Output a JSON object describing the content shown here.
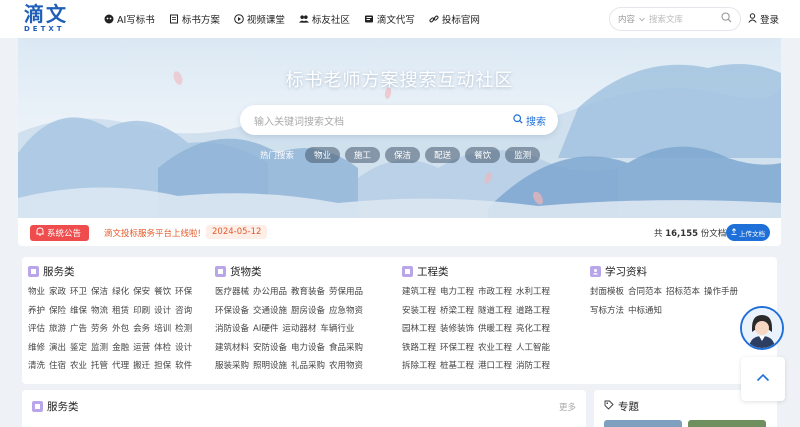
{
  "header": {
    "logo": {
      "main": "滴文",
      "sub": "DETXT"
    },
    "nav": [
      {
        "label": "AI写标书",
        "icon": "robot-icon"
      },
      {
        "label": "标书方案",
        "icon": "document-icon"
      },
      {
        "label": "视频课堂",
        "icon": "play-icon"
      },
      {
        "label": "标友社区",
        "icon": "users-icon"
      },
      {
        "label": "滴文代写",
        "icon": "edit-icon"
      },
      {
        "label": "投标官网",
        "icon": "link-icon"
      }
    ],
    "search": {
      "select": "内容",
      "placeholder": "搜索文库"
    },
    "login": "登录"
  },
  "banner": {
    "title": "标书老师方案搜索互动社区",
    "search_placeholder": "输入关键词搜索文档",
    "search_button": "搜索",
    "hot_label": "热门搜索",
    "hot_tags": [
      "物业",
      "施工",
      "保洁",
      "配送",
      "餐饮",
      "监测"
    ]
  },
  "notice": {
    "badge": "系统公告",
    "text": "滴文投标服务平台上线啦!",
    "date": "2024-05-12",
    "count_prefix": "共",
    "count": "16,155",
    "count_suffix": "份文档",
    "upload": "上传文档"
  },
  "categories": [
    {
      "title": "服务类",
      "rows": [
        [
          "物业",
          "家政",
          "环卫",
          "保洁",
          "绿化",
          "保安",
          "餐饮",
          "环保"
        ],
        [
          "养护",
          "保险",
          "维保",
          "物流",
          "租赁",
          "印刷",
          "设计",
          "咨询"
        ],
        [
          "评估",
          "旅游",
          "广告",
          "劳务",
          "外包",
          "会务",
          "培训",
          "检测"
        ],
        [
          "维修",
          "演出",
          "鉴定",
          "监测",
          "金融",
          "运营",
          "体检",
          "设计"
        ],
        [
          "清洗",
          "住宿",
          "农业",
          "托管",
          "代理",
          "搬迁",
          "担保",
          "软件"
        ]
      ]
    },
    {
      "title": "货物类",
      "rows": [
        [
          "医疗器械",
          "办公用品",
          "教育装备",
          "劳保用品"
        ],
        [
          "环保设备",
          "交通设施",
          "厨房设备",
          "应急物资"
        ],
        [
          "消防设备",
          "AI硬件",
          "运动器材",
          "车辆行业"
        ],
        [
          "建筑材料",
          "安防设备",
          "电力设备",
          "食品采购"
        ],
        [
          "服装采购",
          "照明设施",
          "礼品采购",
          "农用物资"
        ]
      ]
    },
    {
      "title": "工程类",
      "rows": [
        [
          "建筑工程",
          "电力工程",
          "市政工程",
          "水利工程"
        ],
        [
          "安装工程",
          "桥梁工程",
          "隧道工程",
          "道路工程"
        ],
        [
          "园林工程",
          "装修装饰",
          "供暖工程",
          "亮化工程"
        ],
        [
          "铁路工程",
          "环保工程",
          "农业工程",
          "人工智能"
        ],
        [
          "拆除工程",
          "桩基工程",
          "港口工程",
          "消防工程"
        ]
      ]
    },
    {
      "title": "学习资料",
      "rows": [
        [
          "封面模板",
          "合同范本",
          "招标范本",
          "操作手册"
        ],
        [
          "写标方法",
          "中标通知"
        ]
      ]
    }
  ],
  "sections": [
    {
      "title": "服务类",
      "more": "更多"
    },
    {
      "title": "专题"
    }
  ],
  "colors": {
    "brand": "#1f6fd8",
    "notice_red": "#ef4d4d",
    "category_icon": "#b9a6ea"
  }
}
